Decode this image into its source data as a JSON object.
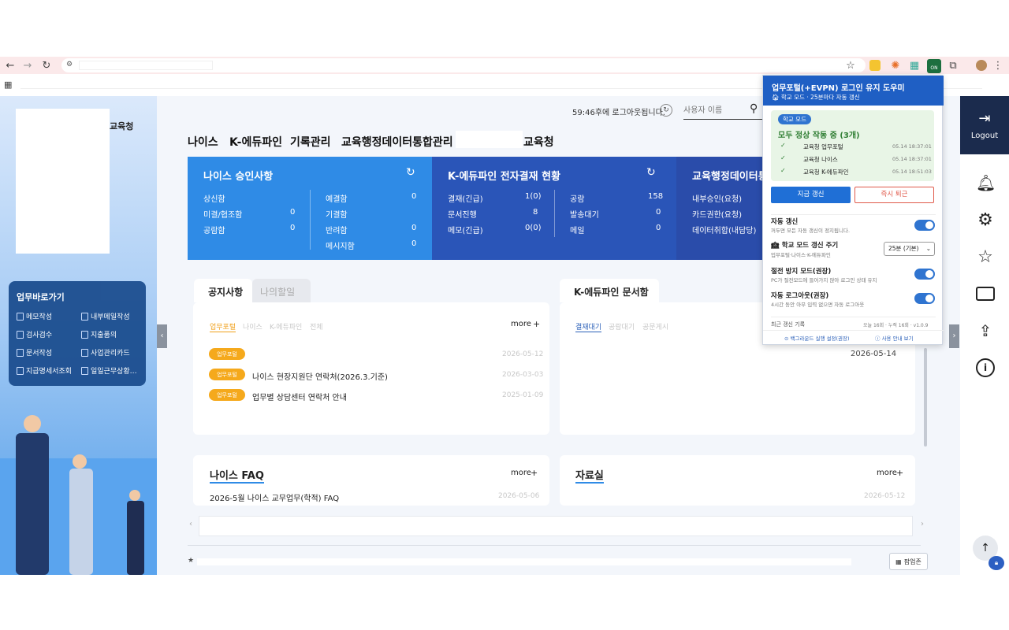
{
  "page": {
    "region": "교육청"
  },
  "timer": {
    "text": "59:46후에 로그아웃됩니다.",
    "search_placeholder": "사용자 이름"
  },
  "nav": [
    "나이스",
    "K-에듀파인",
    "기록관리",
    "교육행정데이터통합관리",
    "교육청"
  ],
  "cards": [
    {
      "title": "나이스 승인사항",
      "left": [
        [
          "상신함",
          "0"
        ],
        [
          "미결/협조함",
          "0"
        ],
        [
          "공람함",
          "0"
        ]
      ],
      "right": [
        [
          "예결함",
          "0"
        ],
        [
          "기결함",
          ""
        ],
        [
          "반려함",
          "0"
        ],
        [
          "메시지함",
          "0"
        ]
      ]
    },
    {
      "title": "K-에듀파인 전자결재 현황",
      "left": [
        [
          "결재(긴급)",
          "1(0)"
        ],
        [
          "문서진행",
          "8"
        ],
        [
          "메모(긴급)",
          "0(0)"
        ]
      ],
      "right": [
        [
          "공람",
          "158"
        ],
        [
          "발송대기",
          "0"
        ],
        [
          "메일",
          "0"
        ]
      ]
    },
    {
      "title": "교육행정데이터통",
      "left": [
        [
          "내부승인(요청)",
          ""
        ],
        [
          "카드권한(요청)",
          ""
        ],
        [
          "데이터취합(내담당)",
          ""
        ]
      ]
    }
  ],
  "quick": {
    "title": "업무바로가기",
    "items": [
      "메모작성",
      "내부메일작성",
      "검사검수",
      "지출품의",
      "문서작성",
      "사업관리카드",
      "지급명세서조회",
      "일일근무상황…"
    ]
  },
  "notice": {
    "tab_active": "공지사항",
    "tab_other": "나의할일",
    "filters": [
      "업무포털",
      "나이스",
      "K-에듀파인",
      "전체"
    ],
    "more": "more",
    "items": [
      {
        "badge": "업무포털",
        "title": "",
        "date": "2026-05-12"
      },
      {
        "badge": "업무포털",
        "title": "나이스 현장지원단 연락처(2026.3.기준)",
        "date": "2026-03-03"
      },
      {
        "badge": "업무포털",
        "title": "업무별 상담센터 연락처 안내",
        "date": "2025-01-09"
      }
    ]
  },
  "docbox": {
    "title": "K-에듀파인 문서함",
    "filters": [
      "결재대기",
      "공람대기",
      "공문게시"
    ],
    "date": "2026-05-14"
  },
  "faq": {
    "title": "나이스 FAQ",
    "more": "more",
    "item": "2026-5월 나이스 교무업무(학적) FAQ",
    "date": "2026-05-06"
  },
  "data_room": {
    "title": "자료실",
    "more": "more",
    "date": "2026-05-12"
  },
  "popup_btn": "팝업존",
  "sidebar": {
    "logout": "Logout"
  },
  "popup": {
    "title": "업무포털(+EVPN) 로그인 유지 도우미",
    "subtitle": "학교 모드 · 25분마다 자동 갱신",
    "mode_badge": "학교 모드",
    "status": "모두 정상 작동 중 (3개)",
    "checks": [
      {
        "name": "교육청 업무포털",
        "time": "05.14 18:37:01"
      },
      {
        "name": "교육청 나이스",
        "time": "05.14 18:37:01"
      },
      {
        "name": "교육청 K-에듀파인",
        "time": "05.14 18:51:03"
      }
    ],
    "refresh_btn": "지금 갱신",
    "leave_btn": "즉시 퇴근",
    "opt1_title": "자동 갱신",
    "opt1_desc": "꺼두면 모든 자동 갱신이 정지됩니다.",
    "opt2_title": "학교 모드 갱신 주기",
    "opt2_desc": "업무포털·나이스·K-에듀파인",
    "opt2_select": "25분 (기본)",
    "opt3_title": "절전 방지 모드(권장)",
    "opt3_desc": "PC가 절전모드에 들어가지 않아 로그인 상태 유지",
    "opt4_title": "자동 로그아웃(권장)",
    "opt4_desc": "4시간 동안 아무 입력 없으면 자동 로그아웃",
    "log_label": "최근 갱신 기록",
    "log_stats": "오늘 16회 · 누적 16회 · v1.0.9",
    "link1": "백그라운드 실행 설정(권장)",
    "link2": "사용 안내 보기"
  },
  "colors": {
    "card1": "#2f8be6",
    "card2": "#2a55b8",
    "card3": "#2a4caa",
    "badge": "#f5a91c",
    "popup_head": "#1f5fc4"
  }
}
